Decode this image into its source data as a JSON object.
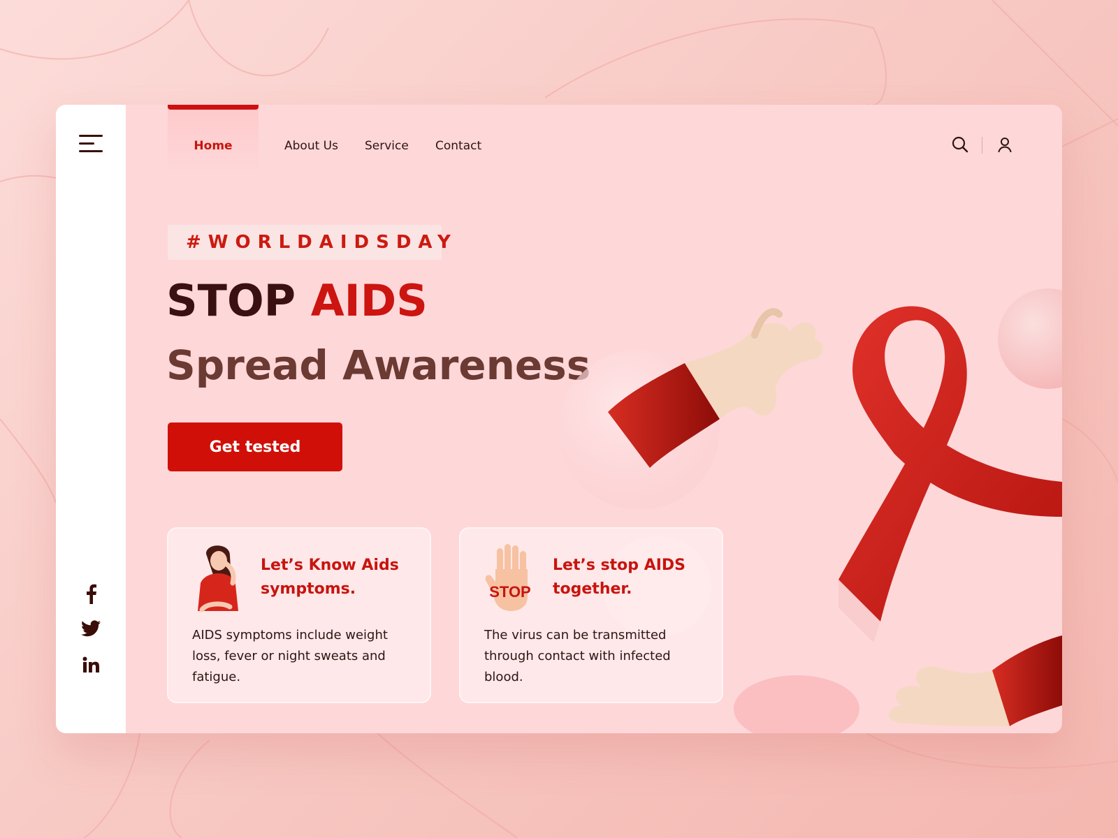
{
  "nav": {
    "items": [
      {
        "label": "Home",
        "active": true
      },
      {
        "label": "About Us"
      },
      {
        "label": "Service"
      },
      {
        "label": "Contact"
      }
    ],
    "search_icon": "search-icon",
    "user_icon": "user-icon"
  },
  "sidebar": {
    "menu_icon": "hamburger-menu-icon",
    "social": [
      "facebook-icon",
      "twitter-icon",
      "linkedin-icon"
    ]
  },
  "hero": {
    "tag": "#WORLDAIDSDAY",
    "headline_part1": "STOP",
    "headline_part2": "AIDS",
    "subheadline": "Spread Awareness",
    "cta_label": "Get tested"
  },
  "cards": [
    {
      "title": "Let’s Know Aids symptoms.",
      "text": "AIDS symptoms include weight loss, fever or night sweats and fatigue."
    },
    {
      "title": "Let’s stop AIDS together.",
      "text": "The virus can be transmitted through contact with infected blood.",
      "illustration_text": "STOP"
    }
  ],
  "colors": {
    "accent": "#d01008",
    "dark": "#3a1010",
    "subhead": "#6b3a32",
    "card_bg": "#fed7d9",
    "page_bg": "#f9cdc8"
  }
}
